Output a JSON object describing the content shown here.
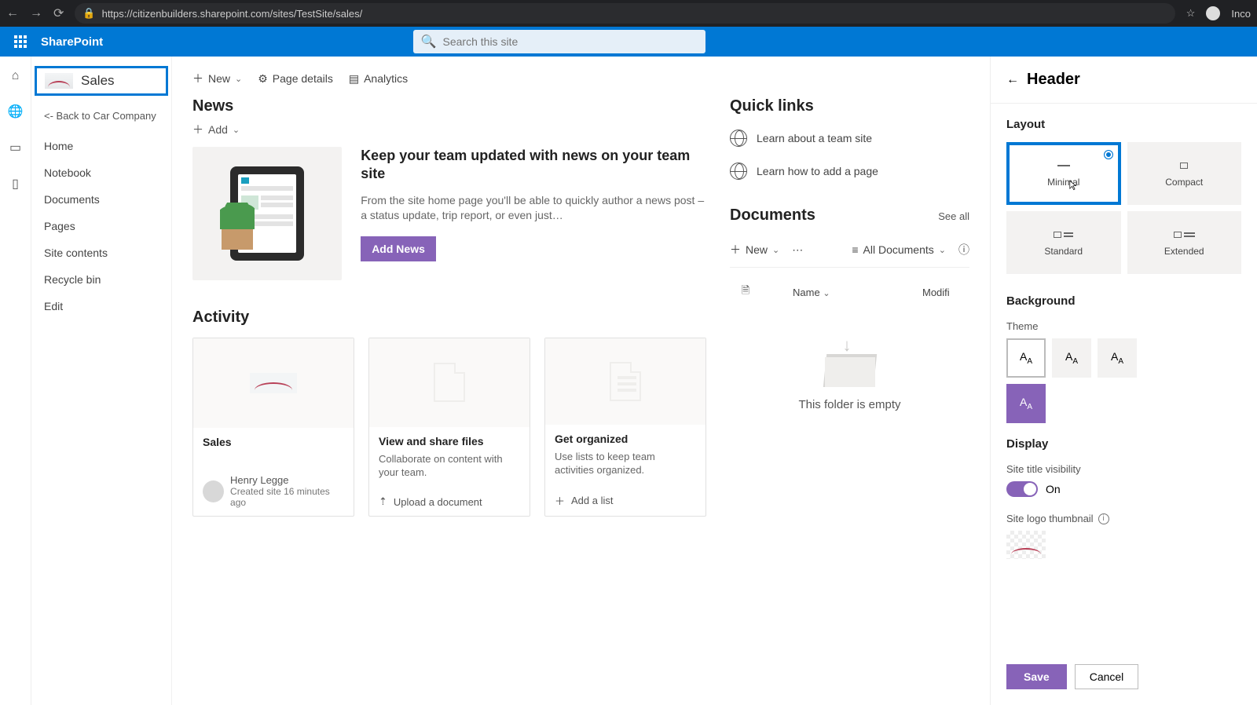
{
  "browser": {
    "url": "https://citizenbuilders.sharepoint.com/sites/TestSite/sales/",
    "profile": "Inco"
  },
  "sp": {
    "brand": "SharePoint",
    "search_placeholder": "Search this site"
  },
  "site": {
    "name": "Sales",
    "back_link": "<- Back to Car Company"
  },
  "nav": {
    "items": [
      "Home",
      "Notebook",
      "Documents",
      "Pages",
      "Site contents",
      "Recycle bin",
      "Edit"
    ]
  },
  "cmdbar": {
    "new": "New",
    "details": "Page details",
    "analytics": "Analytics"
  },
  "news": {
    "heading": "News",
    "add": "Add",
    "title": "Keep your team updated with news on your team site",
    "desc": "From the site home page you'll be able to quickly author a news post – a status update, trip report, or even just…",
    "button": "Add News"
  },
  "activity": {
    "heading": "Activity",
    "cards": [
      {
        "title": "Sales",
        "author": "Henry Legge",
        "meta": "Created site 16 minutes ago"
      },
      {
        "title": "View and share files",
        "desc": "Collaborate on content with your team.",
        "action": "Upload a document"
      },
      {
        "title": "Get organized",
        "desc": "Use lists to keep team activities organized.",
        "action": "Add a list"
      }
    ]
  },
  "quicklinks": {
    "heading": "Quick links",
    "items": [
      "Learn about a team site",
      "Learn how to add a page"
    ]
  },
  "documents": {
    "heading": "Documents",
    "see_all": "See all",
    "new": "New",
    "view": "All Documents",
    "cols": {
      "name": "Name",
      "modified": "Modifi"
    },
    "empty": "This folder is empty"
  },
  "panel": {
    "title": "Header",
    "layout_h": "Layout",
    "layouts": [
      "Minimal",
      "Compact",
      "Standard",
      "Extended"
    ],
    "background_h": "Background",
    "theme_h": "Theme",
    "display_h": "Display",
    "site_title_vis": "Site title visibility",
    "toggle_state": "On",
    "logo_thumb": "Site logo thumbnail",
    "save": "Save",
    "cancel": "Cancel"
  }
}
